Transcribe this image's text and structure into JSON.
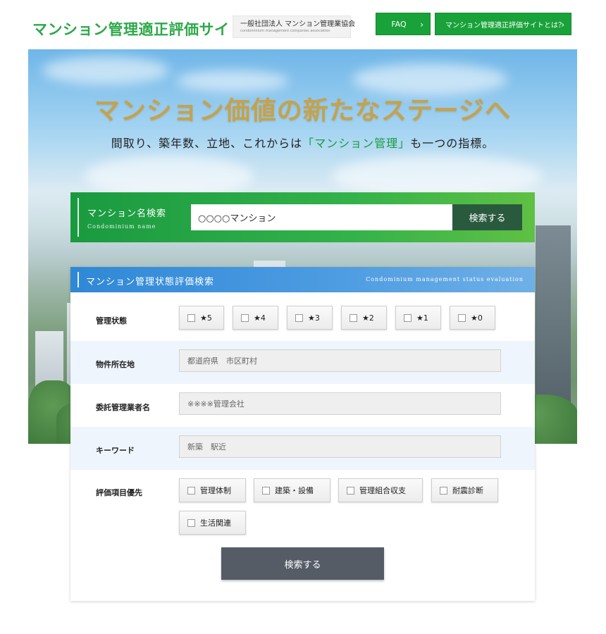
{
  "header": {
    "site_title": "マンション管理適正評価サイト",
    "association_name": "一般社団法人 マンション管理業協会",
    "association_name_en": "condominium management companies association",
    "faq_label": "FAQ",
    "about_label": "マンション管理適正評価サイトとは？"
  },
  "hero": {
    "title": "マンション価値の新たなステージへ",
    "subtitle_before": "間取り、築年数、立地、これからは",
    "subtitle_accent": "「マンション管理」",
    "subtitle_after": "も一つの指標。"
  },
  "name_search": {
    "label": "マンション名検索",
    "label_en": "Condominium name",
    "input_value": "○○○○マンション",
    "button_label": "検索する"
  },
  "evaluation_search": {
    "title": "マンション管理状態評価検索",
    "title_en": "Condominium management status evaluation",
    "status_label": "管理状態",
    "ratings": [
      "★5",
      "★4",
      "★3",
      "★2",
      "★1",
      "★0"
    ],
    "location_label": "物件所在地",
    "location_placeholder": "都道府県　市区町村",
    "company_label": "委託管理業者名",
    "company_placeholder": "※※※※管理会社",
    "keyword_label": "キーワード",
    "keyword_placeholder": "新築　駅近",
    "priority_label": "評価項目優先",
    "priority_items": [
      "管理体制",
      "建築・設備",
      "管理組合収支",
      "耐震診断",
      "生活関連"
    ],
    "submit_label": "検索する"
  },
  "colors": {
    "brand_green": "#1aa23a",
    "title_green": "#2da84a",
    "panel_blue": "#3a8fd9",
    "dark_button": "#555c66",
    "name_button": "#2a5a3e",
    "hero_gold": "#c6a24c"
  }
}
